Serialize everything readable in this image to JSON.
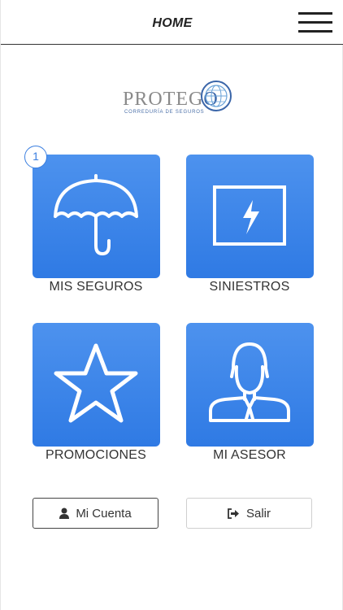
{
  "header": {
    "title": "HOME",
    "menu_icon": "hamburger-menu-icon"
  },
  "logo": {
    "wordmark_start": "PROTEG",
    "wordmark_end": "O",
    "tagline": "CORREDURÍA DE SEGUROS"
  },
  "tiles": [
    {
      "label": "MIS SEGUROS",
      "icon": "umbrella-icon",
      "badge": "1"
    },
    {
      "label": "SINIESTROS",
      "icon": "lightning-screen-icon"
    },
    {
      "label": "PROMOCIONES",
      "icon": "star-icon"
    },
    {
      "label": "MI ASESOR",
      "icon": "advisor-person-icon"
    }
  ],
  "buttons": {
    "account": {
      "label": "Mi Cuenta",
      "icon": "user-icon"
    },
    "exit": {
      "label": "Salir",
      "icon": "sign-out-icon"
    }
  },
  "colors": {
    "tile_blue": "#3b84ea",
    "badge_blue": "#3b7fe0"
  }
}
